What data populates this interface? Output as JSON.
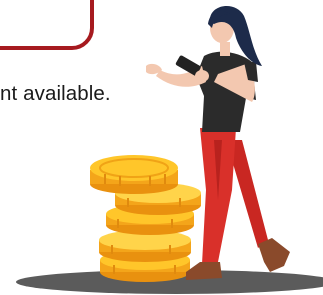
{
  "message": {
    "text": "nt available."
  },
  "illustration": {
    "subject": "woman-with-phone-and-coins",
    "colors": {
      "frame_red": "#a61a1f",
      "shirt": "#2b2b2b",
      "pants": "#d9302a",
      "shoes": "#8a4a2b",
      "hair": "#1d2b4a",
      "skin": "#f3c8b0",
      "coin_light": "#ffc62a",
      "coin_dark": "#e9910f",
      "shadow": "#5b5b5b"
    }
  }
}
